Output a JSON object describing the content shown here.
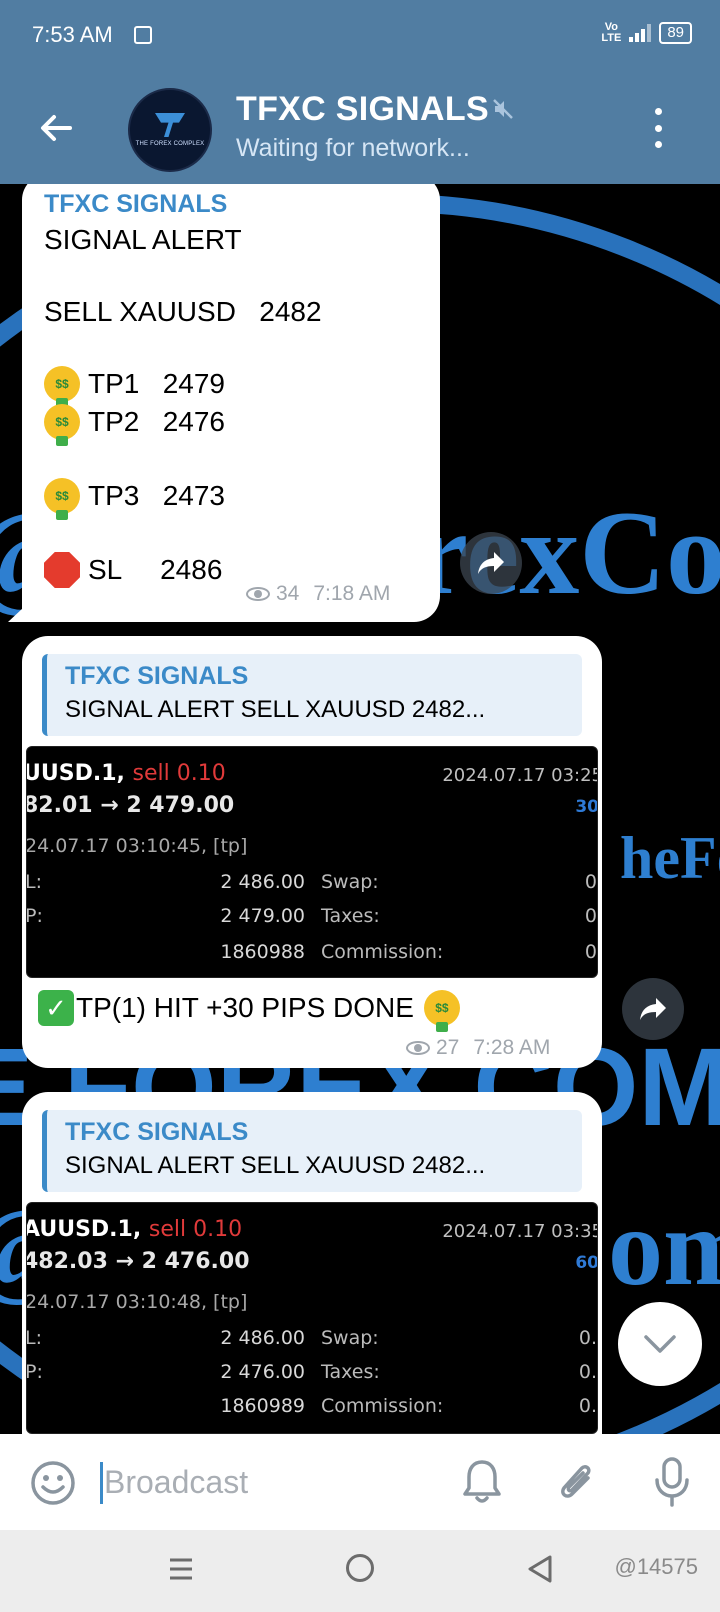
{
  "status_bar": {
    "time": "7:53 AM",
    "volte_top": "Vo",
    "volte_bottom": "LTE",
    "battery": "89"
  },
  "header": {
    "title": "TFXC SIGNALS",
    "status": "Waiting for network..."
  },
  "background": {
    "text_1": "@TheForexCom",
    "text_2": "heFo",
    "text_3": "E FOREX COMP",
    "text_4": "@TheForexCom"
  },
  "messages": [
    {
      "sender": "TFXC SIGNALS",
      "lines": {
        "alert": "SIGNAL ALERT",
        "sell": "SELL XAUUSD   2482",
        "tp1": "TP1   2479",
        "tp2": "TP2   2476",
        "tp3": "TP3   2473",
        "sl": "SL     2486"
      },
      "views": "34",
      "time": "7:18 AM"
    },
    {
      "reply_sender": "TFXC SIGNALS",
      "reply_text": "SIGNAL ALERT  SELL XAUUSD   2482...",
      "screenshot": {
        "symbol": "UUSD.1,",
        "side": "sell 0.10",
        "price": "82.01 → 2 479.00",
        "date": "2024.07.17 03:25",
        "pips": "30",
        "open_time": "24.07.17 03:10:45, [tp]",
        "rows": [
          {
            "label": "L:",
            "value": "2 486.00",
            "key": "Swap:",
            "end": "0"
          },
          {
            "label": "P:",
            "value": "2 479.00",
            "key": "Taxes:",
            "end": "0"
          },
          {
            "label": "",
            "value": "1860988",
            "key": "Commission:",
            "end": "0"
          }
        ]
      },
      "text": "TP(1) HIT +30 PIPS DONE",
      "views": "27",
      "time": "7:28 AM"
    },
    {
      "reply_sender": "TFXC SIGNALS",
      "reply_text": "SIGNAL ALERT  SELL XAUUSD   2482...",
      "screenshot": {
        "symbol": "AUUSD.1,",
        "side": "sell 0.10",
        "price": "482.03 → 2 476.00",
        "date": "2024.07.17 03:35",
        "pips": "60",
        "open_time": "24.07.17 03:10:48, [tp]",
        "rows": [
          {
            "label": "L:",
            "value": "2 486.00",
            "key": "Swap:",
            "end": "0."
          },
          {
            "label": "P:",
            "value": "2 476.00",
            "key": "Taxes:",
            "end": "0."
          },
          {
            "label": "",
            "value": "1860989",
            "key": "Commission:",
            "end": "0."
          }
        ]
      }
    }
  ],
  "input": {
    "placeholder": "Broadcast"
  },
  "nav": {
    "watermark": "@14575"
  },
  "colors": {
    "header": "#517da2",
    "accent": "#3b8ac8",
    "sell": "#e03a3a"
  }
}
